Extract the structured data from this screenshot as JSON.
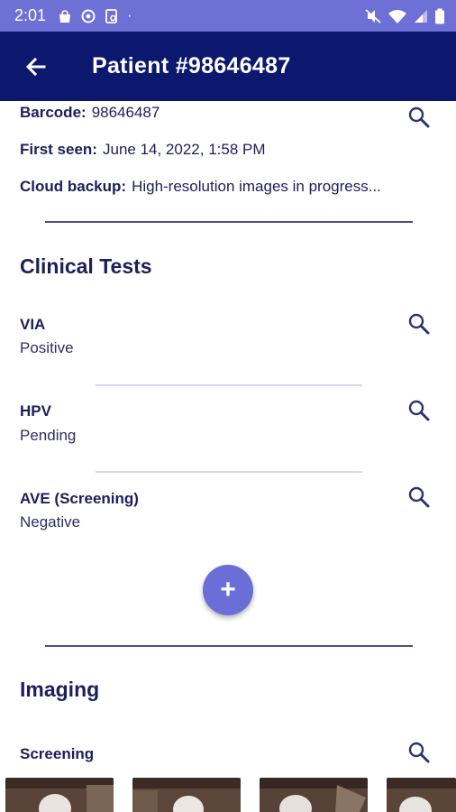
{
  "status_bar": {
    "time": "2:01",
    "dot": "·"
  },
  "app_bar": {
    "title": "Patient #98646487"
  },
  "patient": {
    "barcode_label": "Barcode:",
    "barcode_value": "98646487",
    "first_seen_label": "First seen:",
    "first_seen_value": "June 14, 2022, 1:58 PM",
    "cloud_backup_label": "Cloud backup:",
    "cloud_backup_value": "High-resolution images in progress..."
  },
  "clinical_tests": {
    "title": "Clinical Tests",
    "items": [
      {
        "name": "VIA",
        "result": "Positive"
      },
      {
        "name": "HPV",
        "result": "Pending"
      },
      {
        "name": "AVE (Screening)",
        "result": "Negative"
      }
    ],
    "add_label": "+"
  },
  "imaging": {
    "title": "Imaging",
    "subsection": "Screening"
  },
  "colors": {
    "status_bar": "#6f70d6",
    "app_bar": "#0c176e",
    "text": "#1c1f5a",
    "fab": "#6b6ed7"
  }
}
